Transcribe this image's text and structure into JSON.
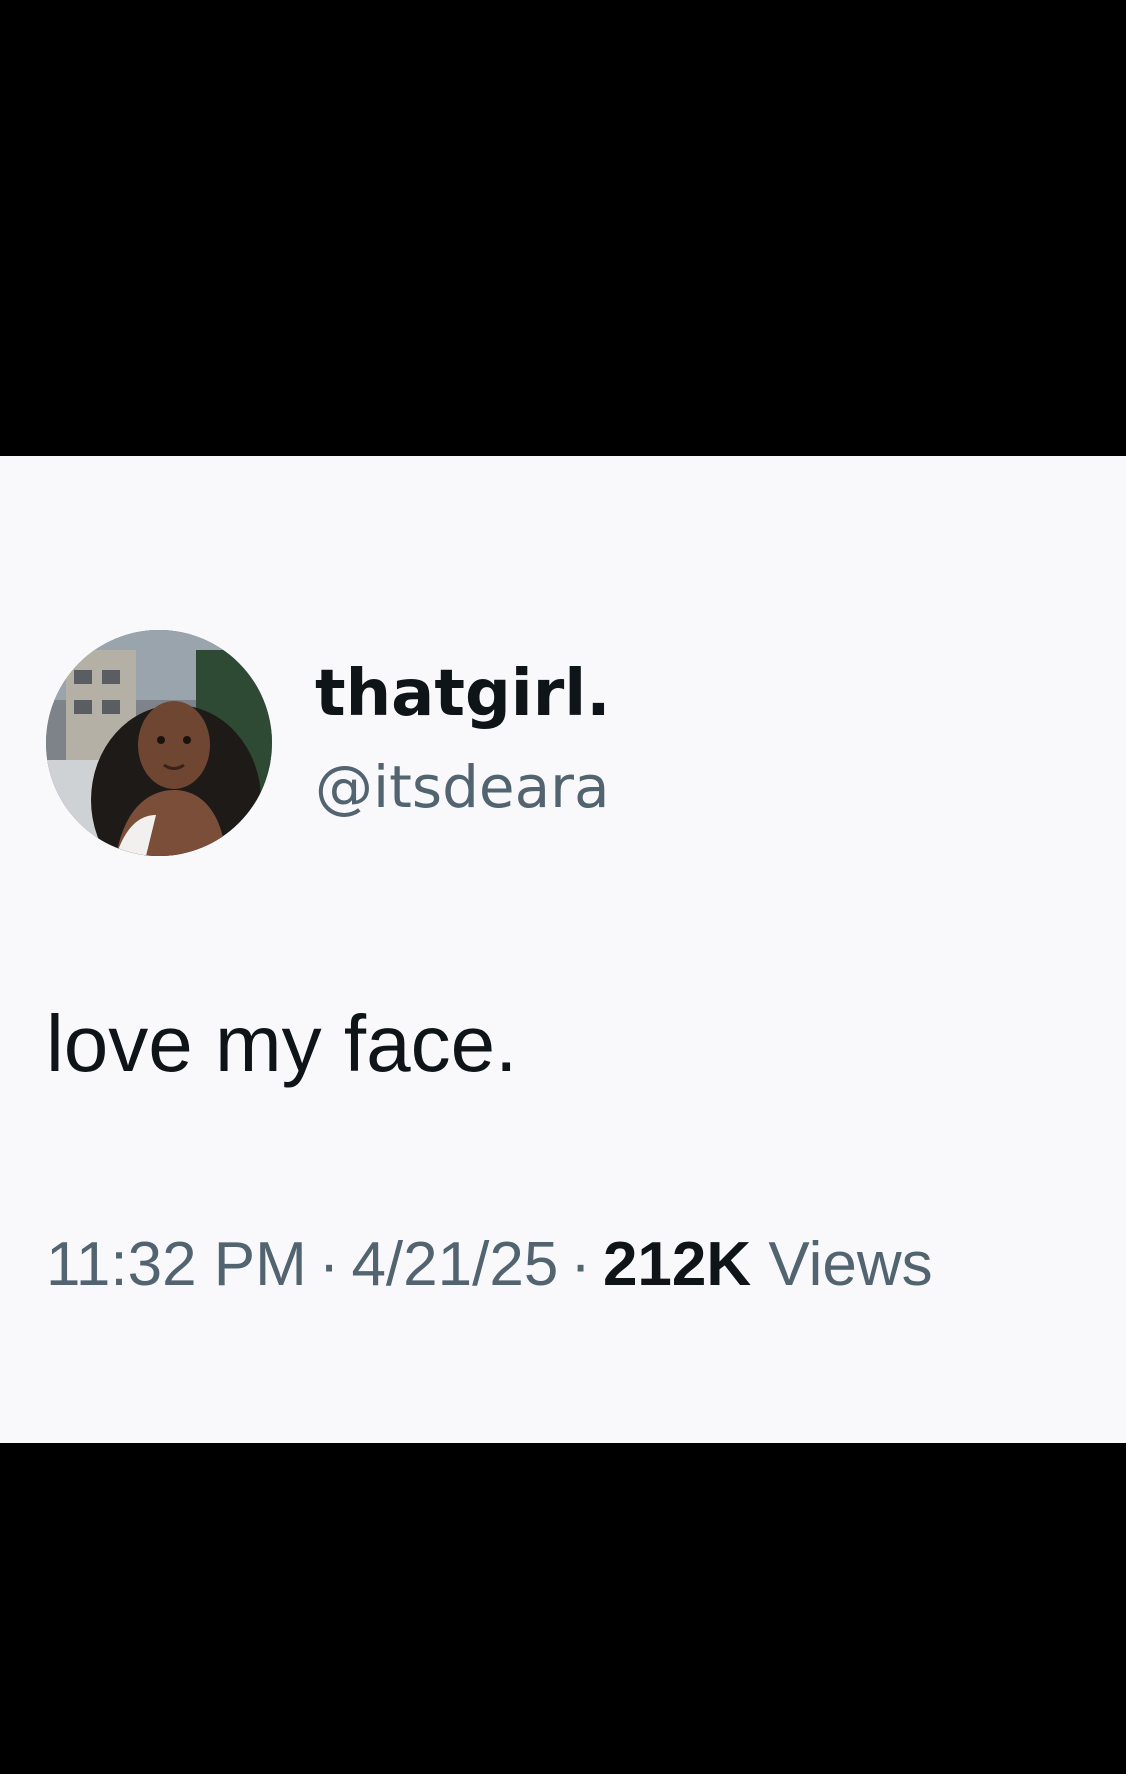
{
  "tweet": {
    "author": {
      "display_name": "thatgirl.",
      "handle": "@itsdeara",
      "avatar_icon": "profile-photo"
    },
    "text": "love my face.",
    "meta": {
      "time": "11:32 PM",
      "separator": "·",
      "date": "4/21/25",
      "views_count": "212K",
      "views_label": "Views"
    }
  },
  "colors": {
    "background_bars": "#000000",
    "card_background": "#f9f9fb",
    "primary_text": "#0f1419",
    "secondary_text": "#536471"
  }
}
